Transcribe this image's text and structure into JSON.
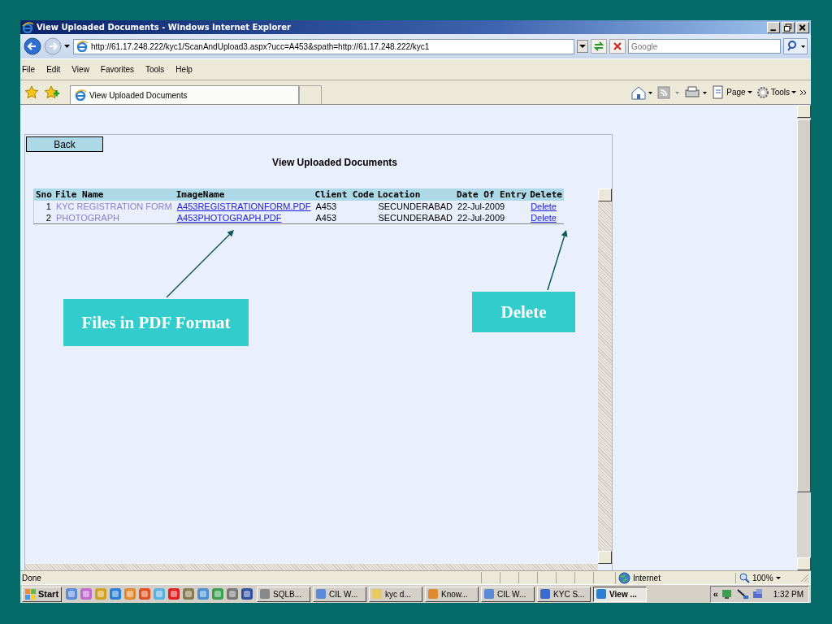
{
  "window": {
    "title": "View Uploaded Documents - Windows Internet Explorer"
  },
  "address_bar": {
    "url": "http://61.17.248.222/kyc1/ScanAndUpload3.aspx?ucc=A453&spath=http://61.17.248.222/kyc1",
    "search_placeholder": "Google"
  },
  "menu": [
    "File",
    "Edit",
    "View",
    "Favorites",
    "Tools",
    "Help"
  ],
  "favorites_bar": {
    "tab_label": "View Uploaded Documents",
    "commands": [
      "Page",
      "Tools"
    ]
  },
  "page": {
    "back_button": "Back",
    "heading": "View Uploaded Documents",
    "table": {
      "columns": [
        "Sno",
        "File Name",
        "ImageName",
        "Client Code",
        "Location",
        "Date Of Entry",
        "Delete"
      ],
      "rows": [
        {
          "sno": "1",
          "file_name": "KYC REGISTRATION FORM",
          "image_name": "A453REGISTRATIONFORM.PDF",
          "client_code": "A453",
          "location": "SECUNDERABAD",
          "date": "22-Jul-2009",
          "delete": "Delete"
        },
        {
          "sno": "2",
          "file_name": "PHOTOGRAPH",
          "image_name": "A453PHOTOGRAPH.PDF",
          "client_code": "A453",
          "location": "SECUNDERABAD",
          "date": "22-Jul-2009",
          "delete": "Delete"
        }
      ]
    }
  },
  "status_bar": {
    "text": "Done",
    "zone": "Internet",
    "zoom": "100%"
  },
  "taskbar": {
    "start": "Start",
    "tasks": [
      {
        "label": "SQLB...",
        "selected": false
      },
      {
        "label": "CIL W...",
        "selected": false
      },
      {
        "label": "kyc d...",
        "selected": false
      },
      {
        "label": "Know...",
        "selected": false
      },
      {
        "label": "CIL W...",
        "selected": false
      },
      {
        "label": "KYC S...",
        "selected": false
      },
      {
        "label": "View ...",
        "selected": true
      }
    ],
    "tray_toggle": "«",
    "clock": "1:32 PM"
  },
  "callouts": [
    {
      "text": "Files in PDF Format"
    },
    {
      "text": "Delete"
    }
  ]
}
